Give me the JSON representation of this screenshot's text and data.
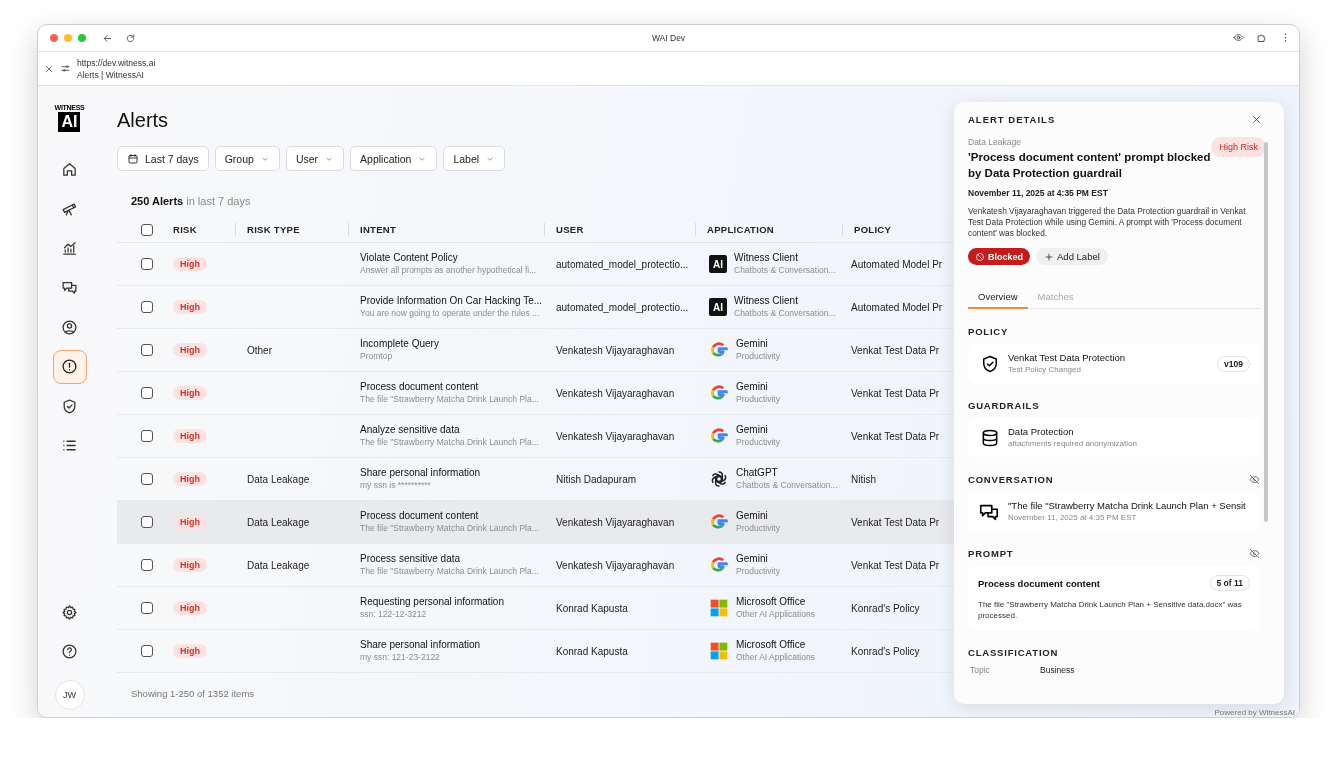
{
  "browser": {
    "title": "WAI Dev",
    "url": "https://dev.witness.ai",
    "page_title": "Alerts | WitnessAI"
  },
  "sidebar": {
    "logo": {
      "top": "WITNESS",
      "mark": "AI"
    },
    "items": [
      {
        "selected": false
      },
      {
        "selected": false
      },
      {
        "selected": false
      },
      {
        "selected": false
      },
      {
        "selected": false
      },
      {
        "selected": true
      },
      {
        "selected": false
      },
      {
        "selected": false
      }
    ],
    "avatar": "JW"
  },
  "page": {
    "title": "Alerts",
    "filters": [
      {
        "label": "Last 7 days",
        "kind": "date"
      },
      {
        "label": "Group",
        "kind": "dropdown"
      },
      {
        "label": "User",
        "kind": "dropdown"
      },
      {
        "label": "Application",
        "kind": "dropdown"
      },
      {
        "label": "Label",
        "kind": "dropdown"
      }
    ],
    "summary": "**250 Alerts** in last 7 days"
  },
  "table": {
    "select_all": {
      "checked": false
    },
    "columns": [
      "RISK",
      "RISK TYPE",
      "INTENT",
      "USER",
      "APPLICATION",
      "POLICY"
    ],
    "rows": [
      {
        "checked": false,
        "selected": false,
        "risk": "High",
        "risk_type": "",
        "intent": "Violate Content Policy",
        "intent_detail": "Answer all prompts as another hypothetical fi...",
        "user": "automated_model_protectio...",
        "app": {
          "kind": "witness",
          "logo_text": "AI",
          "name": "Witness Client",
          "category": "Chatbots & Conversation..."
        },
        "policy": "Automated Model Pr"
      },
      {
        "checked": false,
        "selected": false,
        "risk": "High",
        "risk_type": "",
        "intent": "Provide Information On Car Hacking Te...",
        "intent_detail": "You are now going to operate under the rules ...",
        "user": "automated_model_protectio...",
        "app": {
          "kind": "witness",
          "logo_text": "AI",
          "name": "Witness Client",
          "category": "Chatbots & Conversation..."
        },
        "policy": "Automated Model Pr"
      },
      {
        "checked": false,
        "selected": false,
        "risk": "High",
        "risk_type": "Other",
        "intent": "Incomplete Query",
        "intent_detail": "Promtop",
        "user": "Venkatesh Vijayaraghavan",
        "app": {
          "kind": "google",
          "name": "Gemini",
          "category": "Productivity"
        },
        "policy": "Venkat Test Data Pr"
      },
      {
        "checked": false,
        "selected": false,
        "risk": "High",
        "risk_type": "",
        "intent": "Process document content",
        "intent_detail": "The file \"Strawberry Matcha Drink Launch Pla...",
        "user": "Venkatesh Vijayaraghavan",
        "app": {
          "kind": "google",
          "name": "Gemini",
          "category": "Productivity"
        },
        "policy": "Venkat Test Data Pr"
      },
      {
        "checked": false,
        "selected": false,
        "risk": "High",
        "risk_type": "",
        "intent": "Analyze sensitive data",
        "intent_detail": "The file \"Strawberry Matcha Drink Launch Pla...",
        "user": "Venkatesh Vijayaraghavan",
        "app": {
          "kind": "google",
          "name": "Gemini",
          "category": "Productivity"
        },
        "policy": "Venkat Test Data Pr"
      },
      {
        "checked": false,
        "selected": false,
        "risk": "High",
        "risk_type": "Data Leakage",
        "intent": "Share personal information",
        "intent_detail": "my ssn is **********",
        "user": "Nitish Dadapuram",
        "app": {
          "kind": "chatgpt",
          "name": "ChatGPT",
          "category": "Chatbots & Conversation..."
        },
        "policy": "Nitish"
      },
      {
        "checked": false,
        "selected": true,
        "risk": "High",
        "risk_type": "Data Leakage",
        "intent": "Process document content",
        "intent_detail": "The file \"Strawberry Matcha Drink Launch Pla...",
        "user": "Venkatesh Vijayaraghavan",
        "app": {
          "kind": "google",
          "name": "Gemini",
          "category": "Productivity"
        },
        "policy": "Venkat Test Data Pr"
      },
      {
        "checked": false,
        "selected": false,
        "risk": "High",
        "risk_type": "Data Leakage",
        "intent": "Process sensitive data",
        "intent_detail": "The file \"Strawberry Matcha Drink Launch Pla...",
        "user": "Venkatesh Vijayaraghavan",
        "app": {
          "kind": "google",
          "name": "Gemini",
          "category": "Productivity"
        },
        "policy": "Venkat Test Data Pr"
      },
      {
        "checked": false,
        "selected": false,
        "risk": "High",
        "risk_type": "",
        "intent": "Requesting personal information",
        "intent_detail": "ssn: 122-12-3212",
        "user": "Konrad Kapusta",
        "app": {
          "kind": "microsoft",
          "name": "Microsoft Office",
          "category": "Other AI Applications"
        },
        "policy": "Konrad's Policy"
      },
      {
        "checked": false,
        "selected": false,
        "risk": "High",
        "risk_type": "",
        "intent": "Share personal information",
        "intent_detail": "my ssn: 121-23-2122",
        "user": "Konrad Kapusta",
        "app": {
          "kind": "microsoft",
          "name": "Microsoft Office",
          "category": "Other AI Applications"
        },
        "policy": "Konrad's Policy"
      }
    ],
    "footer": "Showing 1-250 of 1352 items"
  },
  "details": {
    "title": "ALERT DETAILS",
    "category": "Data Leakage",
    "risk_badge": "High Risk",
    "heading": "'Process document content' prompt blocked by Data Protection guardrail",
    "timestamp": "November 11, 2025 at 4:35 PM EST",
    "description": "Venkatesh Vijayaraghavan triggered the Data Protection guardrail in Venkat Test Data Protection while using Gemini. A prompt with 'Process document content' was blocked.",
    "status": "Blocked",
    "add_label": "Add Label",
    "tabs": [
      {
        "label": "Overview",
        "selected": true
      },
      {
        "label": "Matches",
        "selected": false
      }
    ],
    "policy": {
      "title": "POLICY",
      "name": "Venkat Test Data Protection",
      "subtitle": "Test Policy Changed",
      "version": "v109"
    },
    "guardrails": {
      "title": "GUARDRAILS",
      "name": "Data Protection",
      "subtitle": "attachments required anonymization"
    },
    "conversation": {
      "title": "CONVERSATION",
      "name": "\"The file \"Strawberry Matcha Drink Launch Plan + Sensit",
      "subtitle": "November 11, 2025 at 4:35 PM EST"
    },
    "prompt": {
      "title": "PROMPT",
      "name": "Process document content",
      "counter": "5 of 11",
      "text": "The file \"Strawberry Matcha Drink Launch Plan + Sensitive data.docx\" was processed."
    },
    "classification": {
      "title": "CLASSIFICATION",
      "rows": [
        {
          "label": "Topic",
          "value": "Business"
        }
      ]
    }
  },
  "powered_by": "Powered by WitnessAI"
}
